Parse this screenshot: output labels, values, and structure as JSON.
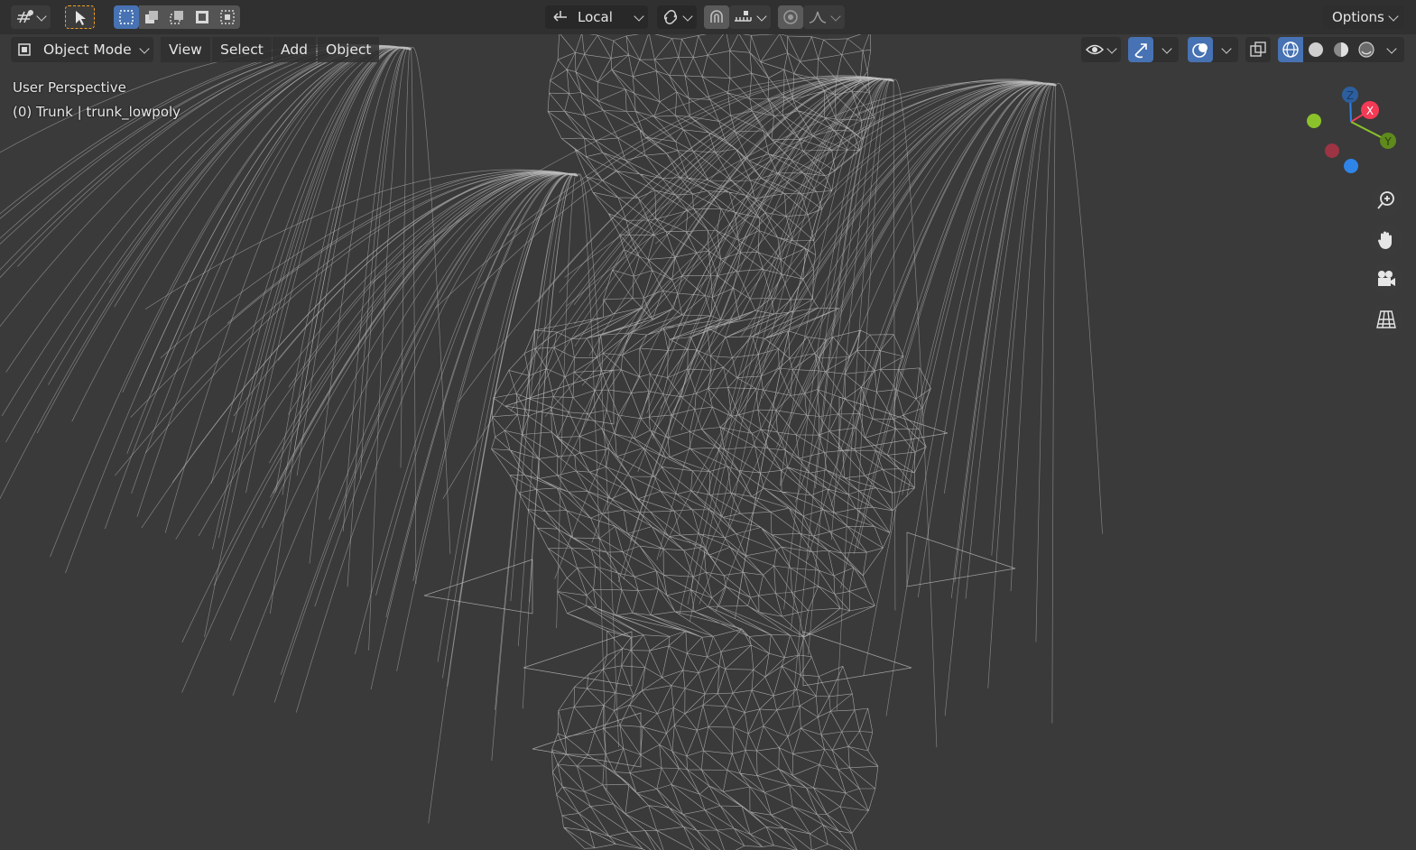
{
  "header": {
    "orientation": "Local",
    "options_label": "Options"
  },
  "viewport_header": {
    "mode": "Object Mode",
    "menus": [
      "View",
      "Select",
      "Add",
      "Object"
    ]
  },
  "overlay": {
    "view_name": "User Perspective",
    "object_info": "(0) Trunk | trunk_lowpoly"
  },
  "gizmo": {
    "x_label": "X",
    "y_label": "Y",
    "z_label": "Z",
    "colors": {
      "x": "#f53a55",
      "y": "#8bc22b",
      "z": "#2f84e8"
    }
  },
  "nav_icons": [
    "zoom-icon",
    "hand-pan-icon",
    "camera-icon",
    "grid-ortho-icon"
  ],
  "colors": {
    "accent": "#4772b3",
    "background": "#3a3a3a",
    "wire": "#bdbdbd"
  }
}
